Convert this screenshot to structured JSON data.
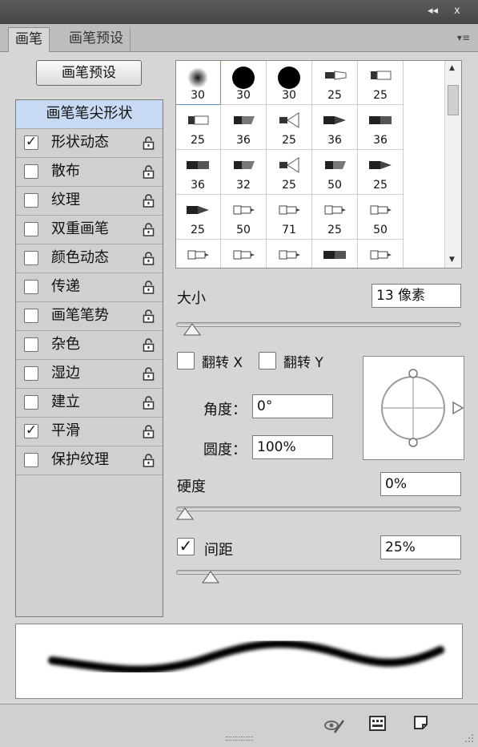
{
  "window": {
    "collapse_label": "◂◂",
    "close_label": "x",
    "menu_label": "▾≡"
  },
  "tabs": [
    {
      "label": "画笔",
      "active": true
    },
    {
      "label": "画笔预设",
      "active": false
    }
  ],
  "preset_button": "画笔预设",
  "left_list": {
    "header": "画笔笔尖形状",
    "items": [
      {
        "label": "形状动态",
        "checked": true
      },
      {
        "label": "散布",
        "checked": false
      },
      {
        "label": "纹理",
        "checked": false
      },
      {
        "label": "双重画笔",
        "checked": false
      },
      {
        "label": "颜色动态",
        "checked": false
      },
      {
        "label": "传递",
        "checked": false
      },
      {
        "label": "画笔笔势",
        "checked": false
      },
      {
        "label": "杂色",
        "checked": false
      },
      {
        "label": "湿边",
        "checked": false
      },
      {
        "label": "建立",
        "checked": false
      },
      {
        "label": "平滑",
        "checked": true
      },
      {
        "label": "保护纹理",
        "checked": false
      }
    ]
  },
  "brush_tips": [
    {
      "size": "30",
      "kind": "soft-round"
    },
    {
      "size": "30",
      "kind": "hard-round"
    },
    {
      "size": "30",
      "kind": "hard-round"
    },
    {
      "size": "25",
      "kind": "bristle"
    },
    {
      "size": "25",
      "kind": "flat"
    },
    {
      "size": "25",
      "kind": "flat"
    },
    {
      "size": "36",
      "kind": "angle"
    },
    {
      "size": "25",
      "kind": "fan"
    },
    {
      "size": "36",
      "kind": "round-point"
    },
    {
      "size": "36",
      "kind": "flat-dark"
    },
    {
      "size": "36",
      "kind": "flat-dark"
    },
    {
      "size": "32",
      "kind": "angle"
    },
    {
      "size": "25",
      "kind": "fan"
    },
    {
      "size": "50",
      "kind": "angle"
    },
    {
      "size": "25",
      "kind": "round-point"
    },
    {
      "size": "25",
      "kind": "round-point"
    },
    {
      "size": "50",
      "kind": "airbrush"
    },
    {
      "size": "71",
      "kind": "airbrush"
    },
    {
      "size": "25",
      "kind": "airbrush"
    },
    {
      "size": "50",
      "kind": "airbrush"
    },
    {
      "size": "",
      "kind": "airbrush"
    },
    {
      "size": "",
      "kind": "airbrush"
    },
    {
      "size": "",
      "kind": "airbrush"
    },
    {
      "size": "",
      "kind": "flat-dark"
    },
    {
      "size": "",
      "kind": "airbrush"
    }
  ],
  "size": {
    "label": "大小",
    "value": "13 像素",
    "slider": 0.05
  },
  "flip_x": {
    "label": "翻转 X",
    "checked": false
  },
  "flip_y": {
    "label": "翻转 Y",
    "checked": false
  },
  "angle": {
    "label": "角度：",
    "value": "0°"
  },
  "roundness": {
    "label": "圆度：",
    "value": "100%"
  },
  "hardness": {
    "label": "硬度",
    "value": "0%",
    "slider": 0.0
  },
  "spacing": {
    "label": "间距",
    "value": "25%",
    "checked": true,
    "slider": 0.25
  },
  "status_icons": [
    "eye-brush-icon",
    "grid-panel-icon",
    "new-preset-icon"
  ]
}
